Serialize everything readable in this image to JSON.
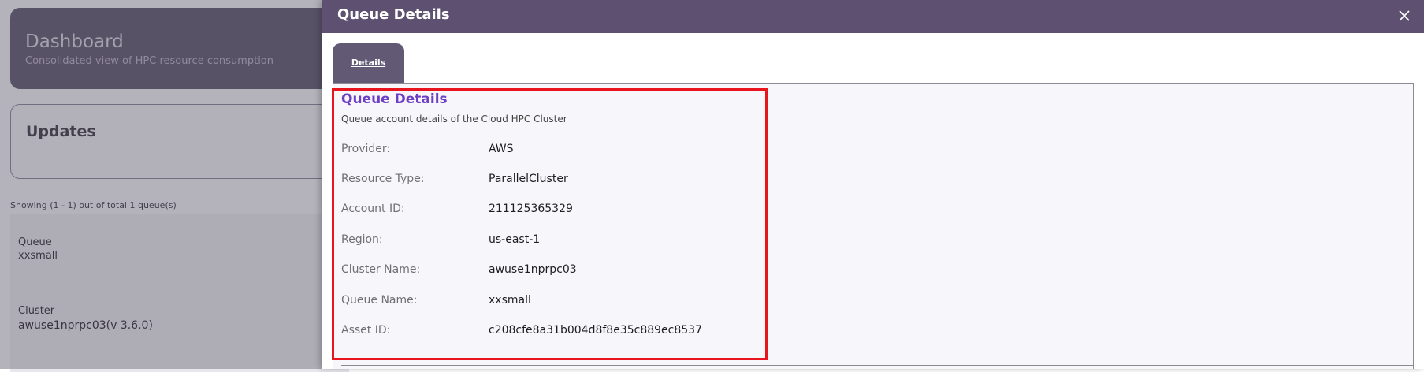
{
  "dashboard": {
    "title": "Dashboard",
    "subtitle": "Consolidated view of HPC resource consumption"
  },
  "updates": {
    "title": "Updates"
  },
  "queue_list": {
    "showing_text": "Showing (1 - 1) out of total 1 queue(s)",
    "queue_label": "Queue",
    "queue_value": "xxsmall",
    "cluster_label": "Cluster",
    "cluster_value": "awuse1nprpc03(v 3.6.0)"
  },
  "drawer": {
    "title": "Queue Details",
    "close_icon": "close-icon",
    "tabs": [
      {
        "label": "Details",
        "active": true
      }
    ],
    "section": {
      "title": "Queue Details",
      "subtitle": "Queue account details of the Cloud HPC Cluster",
      "rows": [
        {
          "label": "Provider:",
          "value": "AWS"
        },
        {
          "label": "Resource Type:",
          "value": "ParallelCluster"
        },
        {
          "label": "Account ID:",
          "value": "211125365329"
        },
        {
          "label": "Region:",
          "value": "us-east-1"
        },
        {
          "label": "Cluster Name:",
          "value": "awuse1nprpc03"
        },
        {
          "label": "Queue Name:",
          "value": "xxsmall"
        },
        {
          "label": "Asset ID:",
          "value": "c208cfe8a31b004d8f8e35c889ec8537"
        }
      ]
    }
  },
  "colors": {
    "header_bg": "#5e5070",
    "accent_title": "#6d3fc4",
    "highlight_border": "#e8141e"
  }
}
